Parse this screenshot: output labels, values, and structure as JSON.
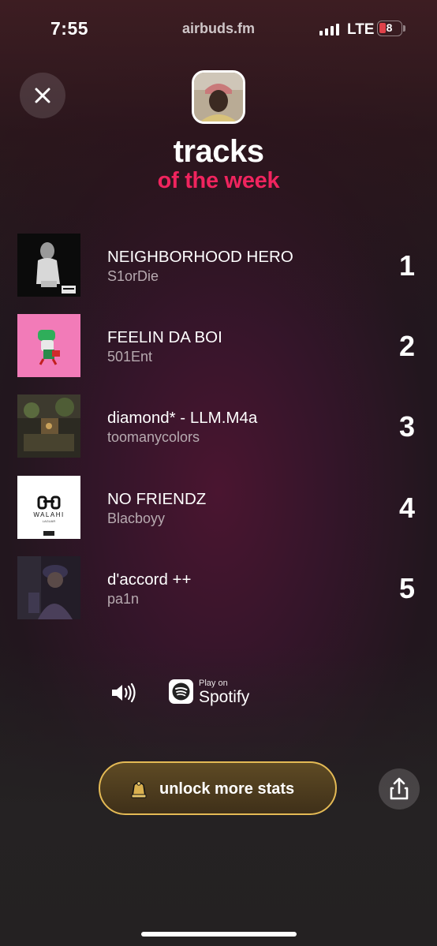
{
  "status_bar": {
    "time": "7:55",
    "url": "airbuds.fm",
    "network": "LTE",
    "battery": "8"
  },
  "header": {
    "title": "tracks",
    "subtitle": "of the week"
  },
  "tracks": [
    {
      "name": "NEIGHBORHOOD HERO",
      "artist": "S1orDie",
      "rank": "1"
    },
    {
      "name": "FEELIN DA BOI",
      "artist": "501Ent",
      "rank": "2"
    },
    {
      "name": "diamond* - LLM.M4a",
      "artist": "toomanycolors",
      "rank": "3"
    },
    {
      "name": "NO FRIENDZ",
      "artist": "Blacboyy",
      "rank": "4"
    },
    {
      "name": "d'accord ++",
      "artist": "pa1n",
      "rank": "5"
    }
  ],
  "artwork_text": {
    "walahi_logo": "WALAHI",
    "walahi_sub": "LAGUAR"
  },
  "player": {
    "play_on": "Play on",
    "service": "Spotify"
  },
  "cta": {
    "unlock_label": "unlock more stats"
  },
  "colors": {
    "accent": "#f0245e",
    "gold": "#e4ba55"
  },
  "icons": [
    "close-icon",
    "speaker-icon",
    "spotify-icon",
    "crown-icon",
    "share-icon"
  ]
}
